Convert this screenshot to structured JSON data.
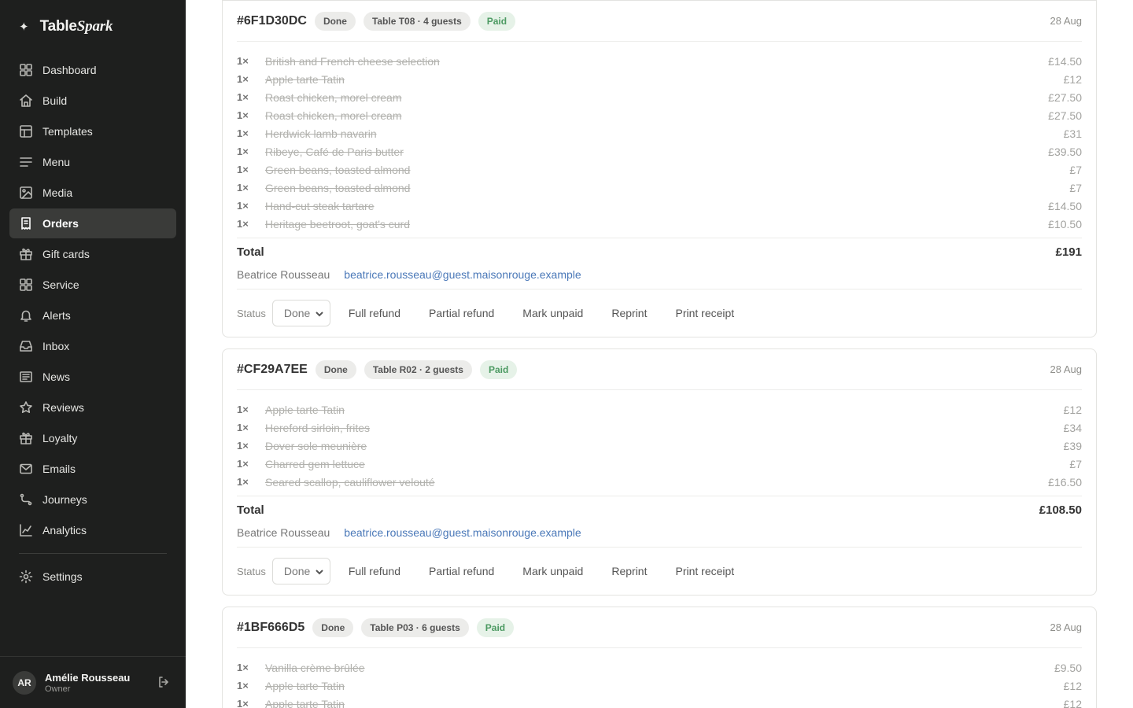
{
  "app": {
    "brand_prefix": "Table",
    "brand_suffix": "Spark"
  },
  "sidebar": {
    "items": [
      {
        "label": "Dashboard",
        "icon": "grid-icon"
      },
      {
        "label": "Build",
        "icon": "home-icon"
      },
      {
        "label": "Templates",
        "icon": "layout-icon"
      },
      {
        "label": "Menu",
        "icon": "lines-icon"
      },
      {
        "label": "Media",
        "icon": "image-icon"
      },
      {
        "label": "Orders",
        "icon": "receipt-icon",
        "active": true
      },
      {
        "label": "Gift cards",
        "icon": "gift-icon"
      },
      {
        "label": "Service",
        "icon": "grid-icon"
      },
      {
        "label": "Alerts",
        "icon": "bell-icon"
      },
      {
        "label": "Inbox",
        "icon": "inbox-icon"
      },
      {
        "label": "News",
        "icon": "newspaper-icon"
      },
      {
        "label": "Reviews",
        "icon": "star-icon"
      },
      {
        "label": "Loyalty",
        "icon": "gift-icon"
      },
      {
        "label": "Emails",
        "icon": "mail-icon"
      },
      {
        "label": "Journeys",
        "icon": "route-icon"
      },
      {
        "label": "Analytics",
        "icon": "chart-icon"
      }
    ],
    "settings_label": "Settings",
    "user": {
      "initials": "AR",
      "name": "Amélie Rousseau",
      "role": "Owner"
    }
  },
  "orders": [
    {
      "id": "#6F1D30DC",
      "state": "Done",
      "table": "Table T08 · 4 guests",
      "payment": "Paid",
      "date": "28 Aug",
      "items": [
        {
          "qty": "1×",
          "name": "British and French cheese selection",
          "price": "£14.50"
        },
        {
          "qty": "1×",
          "name": "Apple tarte Tatin",
          "price": "£12"
        },
        {
          "qty": "1×",
          "name": "Roast chicken, morel cream",
          "price": "£27.50"
        },
        {
          "qty": "1×",
          "name": "Roast chicken, morel cream",
          "price": "£27.50"
        },
        {
          "qty": "1×",
          "name": "Herdwick lamb navarin",
          "price": "£31"
        },
        {
          "qty": "1×",
          "name": "Ribeye, Café de Paris butter",
          "price": "£39.50"
        },
        {
          "qty": "1×",
          "name": "Green beans, toasted almond",
          "price": "£7"
        },
        {
          "qty": "1×",
          "name": "Green beans, toasted almond",
          "price": "£7"
        },
        {
          "qty": "1×",
          "name": "Hand-cut steak tartare",
          "price": "£14.50"
        },
        {
          "qty": "1×",
          "name": "Heritage beetroot, goat's curd",
          "price": "£10.50"
        }
      ],
      "total_label": "Total",
      "total": "£191",
      "customer": "Beatrice Rousseau",
      "email": "beatrice.rousseau@guest.maisonrouge.example",
      "status_label": "Status",
      "status_value": "Done"
    },
    {
      "id": "#CF29A7EE",
      "state": "Done",
      "table": "Table R02 · 2 guests",
      "payment": "Paid",
      "date": "28 Aug",
      "items": [
        {
          "qty": "1×",
          "name": "Apple tarte Tatin",
          "price": "£12"
        },
        {
          "qty": "1×",
          "name": "Hereford sirloin, frites",
          "price": "£34"
        },
        {
          "qty": "1×",
          "name": "Dover sole meunière",
          "price": "£39"
        },
        {
          "qty": "1×",
          "name": "Charred gem lettuce",
          "price": "£7"
        },
        {
          "qty": "1×",
          "name": "Seared scallop, cauliflower velouté",
          "price": "£16.50"
        }
      ],
      "total_label": "Total",
      "total": "£108.50",
      "customer": "Beatrice Rousseau",
      "email": "beatrice.rousseau@guest.maisonrouge.example",
      "status_label": "Status",
      "status_value": "Done"
    },
    {
      "id": "#1BF666D5",
      "state": "Done",
      "table": "Table P03 · 6 guests",
      "payment": "Paid",
      "date": "28 Aug",
      "items": [
        {
          "qty": "1×",
          "name": "Vanilla crème brûlée",
          "price": "£9.50"
        },
        {
          "qty": "1×",
          "name": "Apple tarte Tatin",
          "price": "£12"
        },
        {
          "qty": "1×",
          "name": "Apple tarte Tatin",
          "price": "£12"
        }
      ]
    }
  ],
  "actions": {
    "full_refund": "Full refund",
    "partial_refund": "Partial refund",
    "mark_unpaid": "Mark unpaid",
    "reprint": "Reprint",
    "print_receipt": "Print receipt"
  }
}
